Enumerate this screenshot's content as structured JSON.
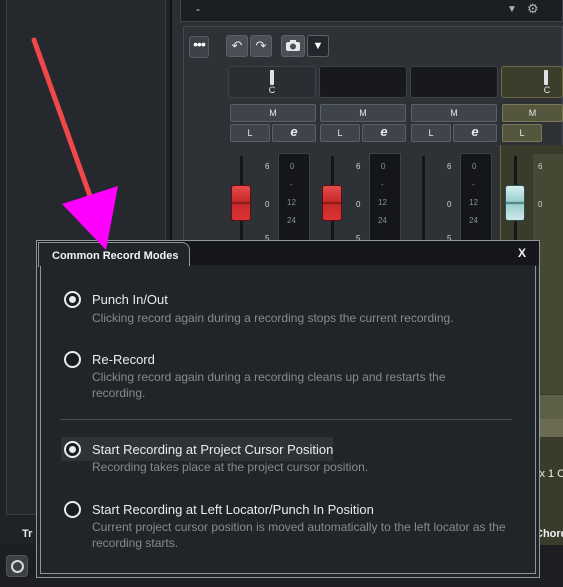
{
  "top_bar": {
    "dash": "-"
  },
  "channel_c_label": "C",
  "channel_buttons": {
    "m": "M",
    "l": "L",
    "e": "e"
  },
  "fader_scale": [
    "6",
    "0",
    "5"
  ],
  "meter_scale": [
    "0",
    "-",
    "12",
    "24"
  ],
  "left_panel": {
    "track_label": "Tr"
  },
  "right_clip": {
    "mix_label": "ix 1 C",
    "chord_label": "Chord"
  },
  "dialog": {
    "title": "Common Record Modes",
    "close": "X",
    "options": [
      {
        "label": "Punch In/Out",
        "description": "Clicking record again during a recording stops the current recording.",
        "selected": true
      },
      {
        "label": "Re-Record",
        "description": "Clicking record again during a recording cleans up and restarts the recording.",
        "selected": false
      },
      {
        "label": "Start Recording at Project Cursor Position",
        "description": "Recording takes place at the project cursor position.",
        "selected": true
      },
      {
        "label": "Start Recording at Left Locator/Punch In Position",
        "description": "Current project cursor position is moved automatically to the left locator as the recording starts.",
        "selected": false
      }
    ]
  },
  "colors": {
    "arrow": "#f04848",
    "arrow_head": "#ff00ff",
    "fader_red": "#d33a3a",
    "fader_teal": "#9bcfcf"
  },
  "icons": {
    "undo": "undo-icon",
    "redo": "redo-icon",
    "camera": "camera-icon",
    "dropdown": "chevron-down-icon",
    "gear": "gear-icon"
  }
}
